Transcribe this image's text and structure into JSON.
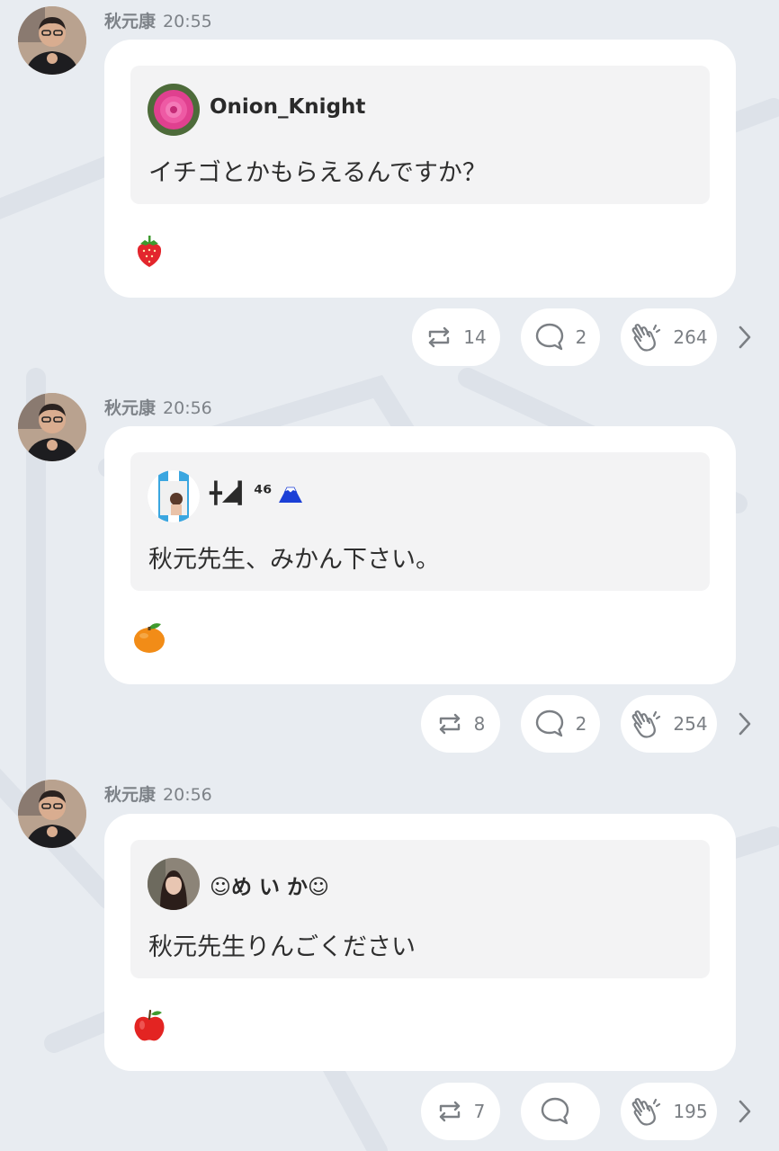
{
  "colors": {
    "background": "#e8ecf1",
    "card": "#ffffff",
    "quote": "#f3f3f4",
    "meta_text": "#7d8288"
  },
  "posts": [
    {
      "author": "秋元康",
      "time": "20:55",
      "quote": {
        "user": "Onion_Knight",
        "text": "イチゴとかもらえるんですか？",
        "avatar_icon": "rose-avatar"
      },
      "reply_emoji": "strawberry-icon",
      "actions": {
        "repost_count": "14",
        "comment_count": "2",
        "clap_count": "264"
      }
    },
    {
      "author": "秋元康",
      "time": "20:56",
      "quote": {
        "user": "╋◢▎⁴⁶",
        "text": "秋元先生、みかん下さい。",
        "avatar_icon": "blue-stripe-avatar",
        "user_suffix_icon": "mount-fuji-icon"
      },
      "reply_emoji": "tangerine-icon",
      "actions": {
        "repost_count": "8",
        "comment_count": "2",
        "clap_count": "254"
      }
    },
    {
      "author": "秋元康",
      "time": "20:56",
      "quote": {
        "user": "☺め い か☺",
        "text": "秋元先生りんごください",
        "avatar_icon": "girl-photo-avatar"
      },
      "reply_emoji": "apple-icon",
      "actions": {
        "repost_count": "7",
        "comment_count": "",
        "clap_count": "195"
      }
    }
  ]
}
